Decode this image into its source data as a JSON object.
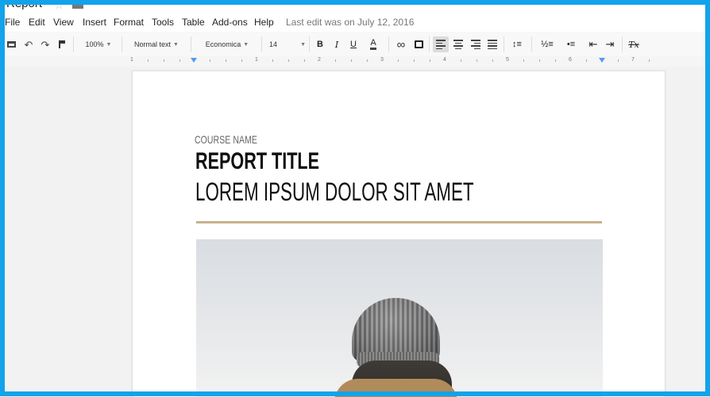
{
  "app": {
    "document_title": "Report"
  },
  "menu": {
    "items": [
      "File",
      "Edit",
      "View",
      "Insert",
      "Format",
      "Tools",
      "Table",
      "Add-ons",
      "Help"
    ],
    "last_edit": "Last edit was on July 12, 2016"
  },
  "toolbar": {
    "zoom": "100%",
    "style": "Normal text",
    "font": "Economica",
    "font_size": "14"
  },
  "ruler": {
    "numbers": [
      "1",
      "1",
      "2",
      "3",
      "4",
      "5",
      "6",
      "7"
    ]
  },
  "document": {
    "course_name": "COURSE NAME",
    "report_title": "REPORT TITLE",
    "subtitle": "LOREM IPSUM DOLOR SIT AMET",
    "accent_color": "#c8b28c"
  },
  "colors": {
    "frame": "#12a3ea",
    "ruler_marker": "#4f9cf0"
  },
  "icons": {
    "star": "star-icon",
    "folder": "folder-icon"
  }
}
